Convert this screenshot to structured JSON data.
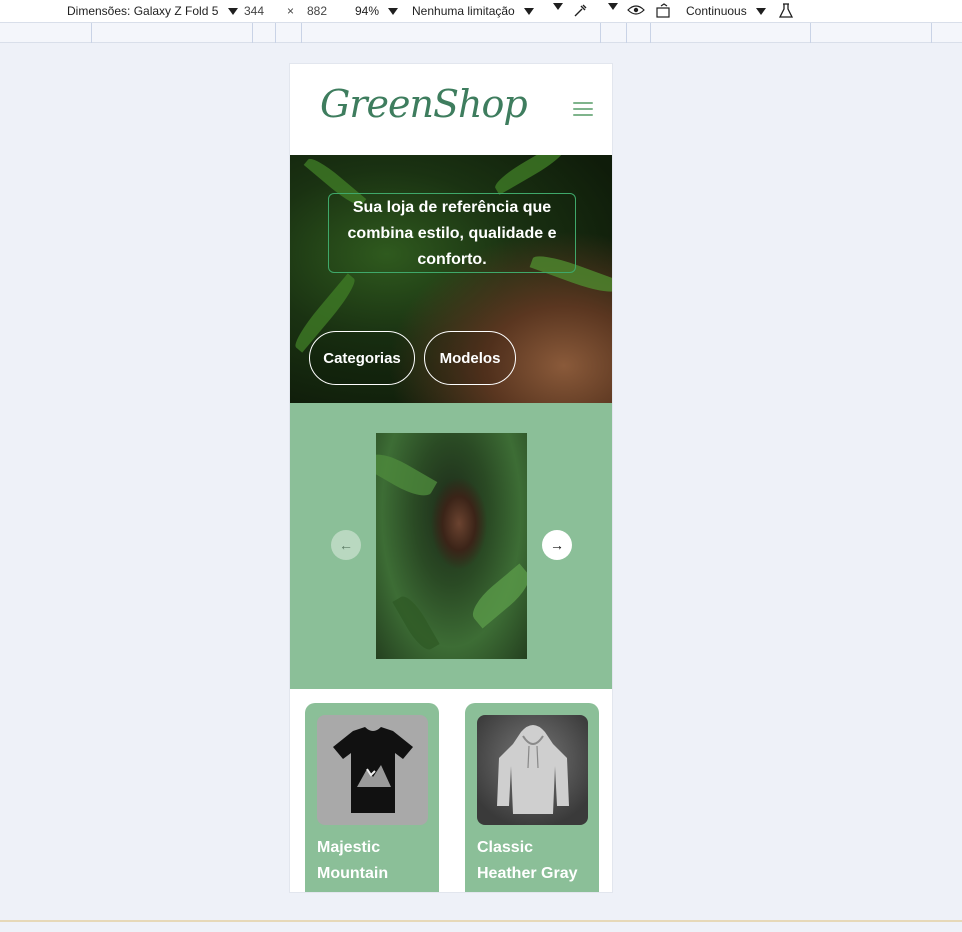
{
  "devtools": {
    "dimensions_label": "Dimensões: Galaxy Z Fold 5",
    "width": "344",
    "times": "×",
    "height": "882",
    "zoom": "94%",
    "throttle": "Nenhuma limitação",
    "mode": "Continuous"
  },
  "site": {
    "logo": "GreenShop",
    "hero_text": "Sua loja de referência que combina estilo, qualidade e conforto.",
    "buttons": [
      "Categorias",
      "Modelos"
    ],
    "carousel": {
      "prev_arrow": "←",
      "next_arrow": "→"
    },
    "products": [
      {
        "title": "Majestic Mountain"
      },
      {
        "title": "Classic Heather Gray"
      }
    ]
  },
  "colors": {
    "brand_green": "#3e7d5e",
    "carousel_bg": "#8bbf98",
    "accent_border": "#3fa86a"
  }
}
